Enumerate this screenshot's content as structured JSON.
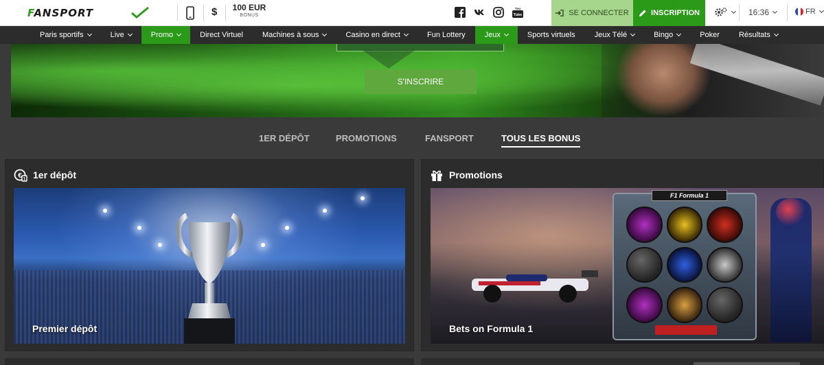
{
  "brand": {
    "logo_text": "FANSPORT",
    "accent": "#2a9a18"
  },
  "header": {
    "bonus_amount": "100 EUR",
    "bonus_label": "BONUS",
    "currency_symbol": "$",
    "login_label": "SE CONNECTER",
    "register_label": "INSCRIPTION",
    "time": "16:36",
    "language": "FR",
    "social": [
      "facebook-icon",
      "vk-icon",
      "instagram-icon",
      "youtube-icon"
    ]
  },
  "nav": {
    "items": [
      {
        "label": "Paris sportifs",
        "dropdown": true,
        "active": false
      },
      {
        "label": "Live",
        "dropdown": true,
        "active": false
      },
      {
        "label": "Promo",
        "dropdown": true,
        "active": true
      },
      {
        "label": "Direct Virtuel",
        "dropdown": false,
        "active": false
      },
      {
        "label": "Machines à sous",
        "dropdown": true,
        "active": false
      },
      {
        "label": "Casino en direct",
        "dropdown": true,
        "active": false
      },
      {
        "label": "Fun Lottery",
        "dropdown": false,
        "active": false
      },
      {
        "label": "Jeux",
        "dropdown": true,
        "active": true
      },
      {
        "label": "Sports virtuels",
        "dropdown": false,
        "active": false
      },
      {
        "label": "Jeux Télé",
        "dropdown": true,
        "active": false
      },
      {
        "label": "Bingo",
        "dropdown": true,
        "active": false
      },
      {
        "label": "Poker",
        "dropdown": false,
        "active": false
      },
      {
        "label": "Résultats",
        "dropdown": true,
        "active": false
      }
    ]
  },
  "hero": {
    "cta_label": "S'INSCRIRE"
  },
  "tabs": {
    "items": [
      "1ER DÉPÔT",
      "PROMOTIONS",
      "FANSPORT",
      "TOUS LES BONUS"
    ],
    "active": "TOUS LES BONUS"
  },
  "cards": {
    "first_deposit": {
      "title": "1er dépôt",
      "caption": "Premier dépôt"
    },
    "promotions": {
      "title": "Promotions",
      "caption": "Bets on Formula 1",
      "slot_title": "F1 Formula 1"
    }
  }
}
